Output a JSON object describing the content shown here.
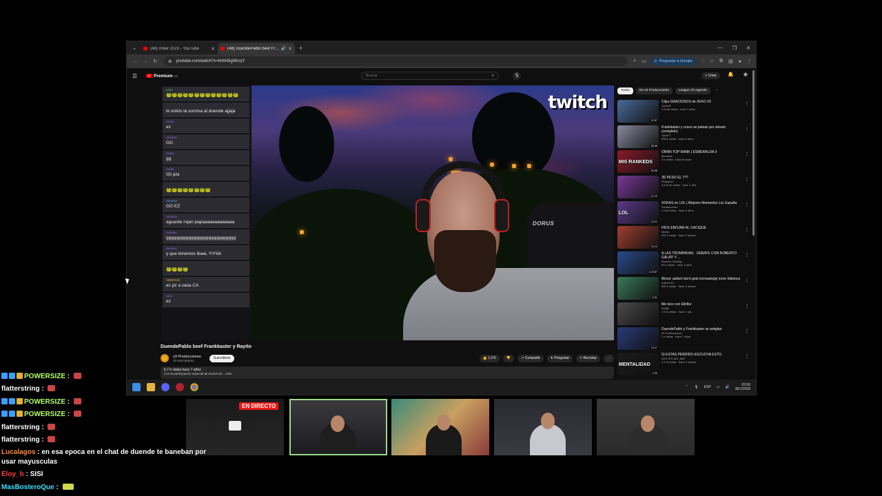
{
  "browser": {
    "tabs": [
      {
        "title": "(48) c0ker 2023 - YouTube",
        "active": false
      },
      {
        "title": "(48) DuendePablo beef Frankkaster y Rayito - YouTube",
        "active": true
      }
    ],
    "url": "youtube.com/watch?v=khbN5gWrcqY",
    "google_button": "Preguntar a Google"
  },
  "youtube": {
    "logo": "Premium",
    "search_placeholder": "Buscar",
    "create_label": "+ Crear",
    "video": {
      "title": "DuendePablo beef Frankkaster y Rayito",
      "channel": "s3 Producciones",
      "subscribers": "10 suscriptores",
      "subscribe": "Suscribirse",
      "likes": "1,3 K",
      "share": "Compartir",
      "save": "Preguntar",
      "clip": "Recortar",
      "views_line": "6,7 k vistas  hace 7 años",
      "desc_line": "Con la participación especial de Dorius xD ...más",
      "watermark": "twitch",
      "chair_brand": "DORUS"
    },
    "vod_chat": [
      {
        "name": "xXxx",
        "text": "🐸🐸🐸🐸🐸🐸🐸🐸🐸🐸🐸🐸🐸",
        "color": "c3"
      },
      {
        "name": "",
        "text": "le volvio la sonrisa al duende ajjaja",
        "color": ""
      },
      {
        "name": "xxxxx",
        "text": "ez",
        "color": "c2"
      },
      {
        "name": "xxxxxxx",
        "text": "GG",
        "color": "c2"
      },
      {
        "name": "xxxxx",
        "text": "gg",
        "color": "c2"
      },
      {
        "name": "xxxxx",
        "text": "ISI pisi",
        "color": "c2"
      },
      {
        "name": "",
        "text": "🐸🐸🐸🐸🐸🐸🐸🐸",
        "color": ""
      },
      {
        "name": "xxxxxxx",
        "text": "GG EZ",
        "color": ""
      },
      {
        "name": "xxxxxxx",
        "text": "aguante rojan papaaaaaaaaaaaaa",
        "color": "c2"
      },
      {
        "name": "xxxxxxx",
        "text": "gggggggggggggggggggggggggggg",
        "color": "c2"
      },
      {
        "name": "xxxxxxx",
        "text": "y que tenemos ibaai, YIYIiiii",
        "color": "c2"
      },
      {
        "name": "",
        "text": "🐸🐸🐸🐸",
        "color": ""
      },
      {
        "name": "AMOGUS",
        "text": "ez pz a casa CA",
        "color": "c4"
      },
      {
        "name": "xxxx",
        "text": "ez",
        "color": "c2"
      }
    ],
    "chips": [
      "Todos",
      "De s3 Producciones",
      "League of Legends"
    ],
    "recommendations": [
      {
        "title": "Clips GRACIOSOS de ZEKO #3",
        "channel": "Jontrelf",
        "views": "2 M de vistas · hace 7 años",
        "duration": "12:57",
        "thumb": "#4a6a9a"
      },
      {
        "title": "Frankkaster y cosco se pelean por stream (completo)",
        "channel": "TadeFT",
        "views": "598 k vistas · hace 8 años",
        "duration": "28:46",
        "thumb": "#8a8aa0"
      },
      {
        "title": "ORNN TOP RANK | ESMERALDA 3",
        "channel": "Mendoliz",
        "views": "2 k vistas · hace 6 horas",
        "duration": "26:58",
        "thumb": "#8a1a2a",
        "label": "MIS RANKEDS"
      },
      {
        "title": "3D PESO EL ???",
        "channel": "Pimpeam",
        "views": "4,8 M de vistas · hace 1 año",
        "duration": "11:13",
        "thumb": "#7a3a9a"
      },
      {
        "title": "XOKAS en LOL | Mejores Momentos LoL España",
        "channel": "Rosalezones",
        "views": "2,3 M vistas · hace 4 años",
        "duration": "13:11",
        "thumb": "#5a3a8a",
        "label": "LOL"
      },
      {
        "title": "HICE ENOJAR AL CACIQUE",
        "channel": "Mefrio",
        "views": "284 k vistas · hace 2 meses",
        "duration": "24:14",
        "thumb": "#a04030"
      },
      {
        "title": "A LAS TROMPADAS · DEBATE CON ROBERTO GALATI Y ...",
        "channel": "Romero Gaming",
        "views": "63 k vistas · hace 3 años",
        "duration": "1:00:57",
        "thumb": "#2a4a8a"
      },
      {
        "title": "Messi: autism but it gets increasingly more hilarious",
        "channel": "Instinct 61",
        "views": "520 k vistas · hace 3 meses",
        "duration": "2:51",
        "thumb": "#3a7a5a"
      },
      {
        "title": "Me toco con Ellrillor",
        "channel": "Wolfjk",
        "views": "178 k vistas · hace 1 día",
        "duration": "",
        "thumb": "#4a4a4a"
      },
      {
        "title": "DuendePablo y Frankkaster se amiglan",
        "channel": "s3 Producciones",
        "views": "2 k vistas · hace 7 años",
        "duration": "12:17",
        "thumb": "#2a3a7a"
      },
      {
        "title": "SI ESTAS PERDIDO ESCUCHA ESTO.",
        "channel": "DOC IPS INC_BAP",
        "views": "1,1 M vistas · hace 4 meses",
        "duration": "4:29",
        "thumb": "#1a1a1a",
        "label": "MENTALIDAD"
      }
    ]
  },
  "taskbar": {
    "lang": "ESP",
    "time": "02:06",
    "date": "30/1/2026"
  },
  "stream_bar": {
    "live_label": "EN DIRECTO"
  },
  "stream_chat": [
    {
      "user": "POWERSIZE",
      "sep": " : ",
      "msg": "",
      "style": "power",
      "badges": true,
      "emote": true
    },
    {
      "user": "flatterstring",
      "sep": " : ",
      "msg": "",
      "style": "",
      "badges": false,
      "emote": true
    },
    {
      "user": "POWERSIZE",
      "sep": " : ",
      "msg": "",
      "style": "power",
      "badges": true,
      "emote": true
    },
    {
      "user": "POWERSIZE",
      "sep": " : ",
      "msg": "",
      "style": "power",
      "badges": true,
      "emote": true
    },
    {
      "user": "flatterstring",
      "sep": " : ",
      "msg": "",
      "style": "",
      "badges": false,
      "emote": true
    },
    {
      "user": "flatterstring",
      "sep": " : ",
      "msg": "",
      "style": "",
      "badges": false,
      "emote": true
    },
    {
      "user": "Lucalagos",
      "sep": " : ",
      "msg": "en esa epoca en el chat de duende te baneban por usar mayusculas",
      "style": "luca",
      "badges": false,
      "emote": false
    },
    {
      "user": "Eloy_b",
      "sep": " : ",
      "msg": "SISI",
      "style": "eloy",
      "badges": false,
      "emote": false
    },
    {
      "user": "MasBosteroQue",
      "sep": " : ",
      "msg": "",
      "style": "mas",
      "badges": false,
      "emote": true,
      "emote_alt": true
    }
  ]
}
